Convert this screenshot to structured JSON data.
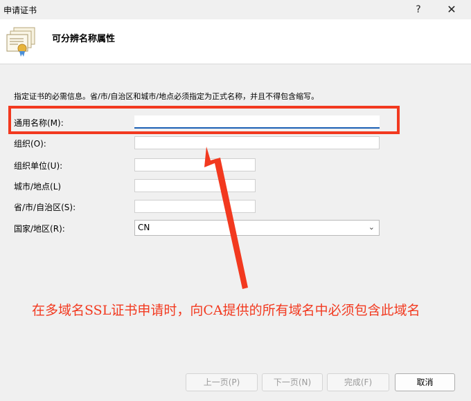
{
  "window": {
    "title": "申请证书",
    "help_glyph": "?",
    "close_glyph": "✕"
  },
  "header": {
    "title": "可分辨名称属性"
  },
  "instruction": "指定证书的必需信息。省/市/自治区和城市/地点必须指定为正式名称，并且不得包含缩写。",
  "fields": [
    {
      "label": "通用名称(M):",
      "value": ""
    },
    {
      "label": "组织(O):",
      "value": ""
    },
    {
      "label": "组织单位(U):",
      "value": ""
    },
    {
      "label": "城市/地点(L)",
      "value": ""
    },
    {
      "label": "省/市/自治区(S):",
      "value": ""
    },
    {
      "label": "国家/地区(R):",
      "value": "CN"
    }
  ],
  "annotation": "在多域名SSL证书申请时，向CA提供的所有域名中必须包含此域名",
  "buttons": {
    "back": "上一页(P)",
    "next": "下一页(N)",
    "finish": "完成(F)",
    "cancel": "取消"
  },
  "colors": {
    "annotation_red": "#f2391f",
    "focus_blue": "#1a5fb4"
  }
}
